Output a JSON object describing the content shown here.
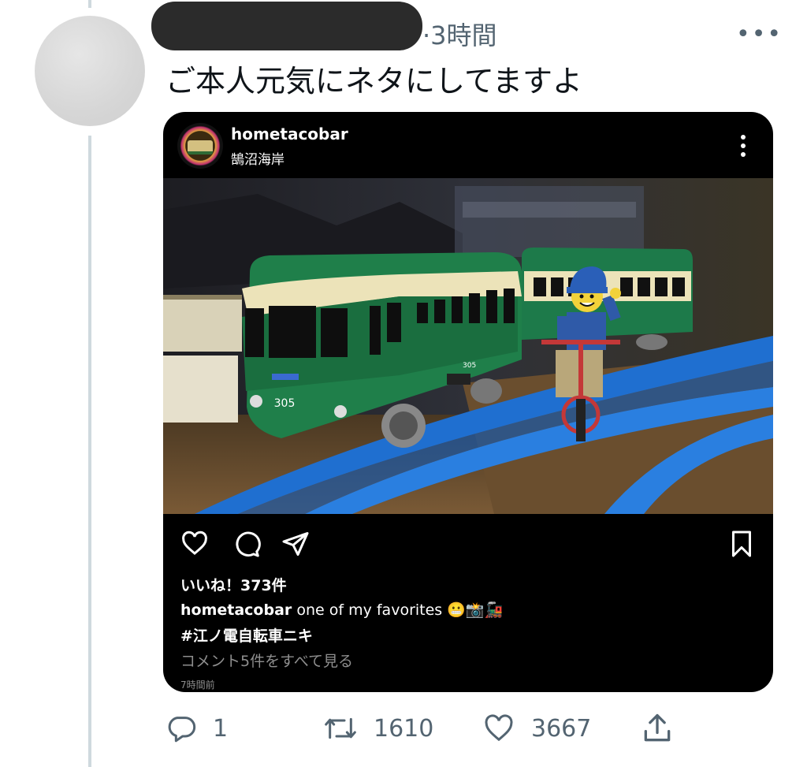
{
  "tweet": {
    "time": "3時間",
    "text": "ご本人元気にネタにしてますよ",
    "replies": "1",
    "retweets": "1610",
    "likes": "3667"
  },
  "embed": {
    "username": "hometacobar",
    "location": "鵠沼海岸",
    "likes_label": "いいね！373件",
    "caption_user": "hometacobar",
    "caption_text": "one of my favorites 😬📸🚂",
    "hashtag": "#江ノ電自転車ニキ",
    "view_comments": "コメント5件をすべて見る",
    "posted": "7時間前",
    "train_number": "305"
  }
}
